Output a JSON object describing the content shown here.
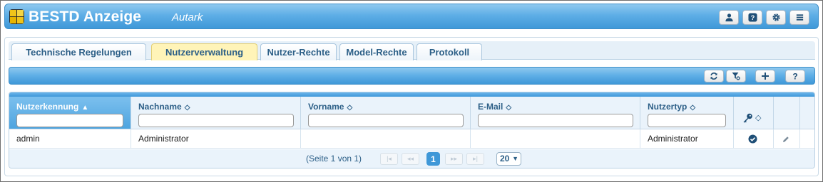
{
  "app": {
    "title": "BESTD Anzeige",
    "subtitle": "Autark",
    "header_buttons": [
      {
        "icon": "user-icon"
      },
      {
        "icon": "help-icon"
      },
      {
        "icon": "gear-icon"
      },
      {
        "icon": "menu-icon"
      }
    ]
  },
  "tabs": [
    {
      "label": "Technische Regelungen",
      "active": false
    },
    {
      "label": "Nutzerverwaltung",
      "active": true
    },
    {
      "label": "Nutzer-Rechte",
      "active": false
    },
    {
      "label": "Model-Rechte",
      "active": false
    },
    {
      "label": "Protokoll",
      "active": false
    }
  ],
  "toolbar": {
    "buttons": [
      {
        "icon": "refresh-icon"
      },
      {
        "icon": "clear-filter-icon"
      },
      {
        "icon": "add-icon"
      },
      {
        "icon": "help-icon"
      }
    ]
  },
  "grid": {
    "columns": [
      {
        "label": "Nutzerkennung",
        "sorted": "asc"
      },
      {
        "label": "Nachname",
        "sorted": null
      },
      {
        "label": "Vorname",
        "sorted": null
      },
      {
        "label": "E-Mail",
        "sorted": null
      },
      {
        "label": "Nutzertyp",
        "sorted": null
      },
      {
        "label": "",
        "icon": "key-icon"
      },
      {
        "label": ""
      },
      {
        "label": ""
      }
    ],
    "filters": [
      "",
      "",
      "",
      "",
      ""
    ],
    "rows": [
      {
        "nutzerkennung": "admin",
        "nachname": "Administrator",
        "vorname": "",
        "email": "",
        "nutzertyp": "Administrator",
        "key_status": "check-icon",
        "action": "edit-icon"
      }
    ]
  },
  "pager": {
    "status_text": "(Seite 1 von 1)",
    "current_page": "1",
    "page_size": "20"
  },
  "colors": {
    "header_blue": "#4ea4df",
    "active_tab": "#fff4b8",
    "link_text": "#2c5f87"
  }
}
